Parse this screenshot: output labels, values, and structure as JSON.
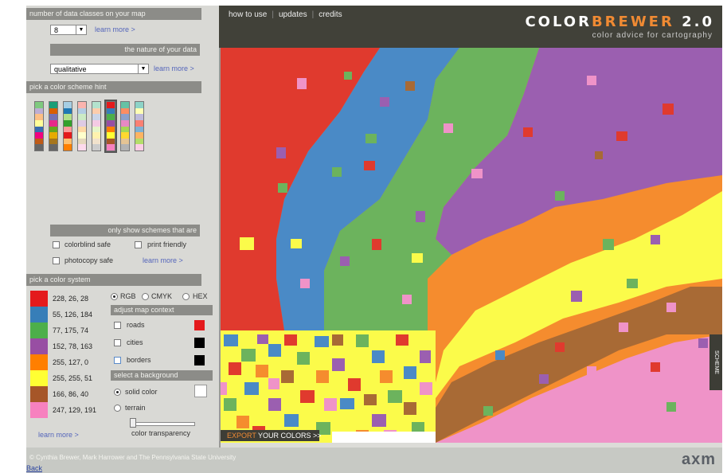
{
  "left": {
    "classes": {
      "header": "number of data classes on your map",
      "value": "8",
      "learn_more": "learn more >"
    },
    "nature": {
      "header": "the nature of your data",
      "value": "qualitative",
      "learn_more": "learn more >"
    },
    "scheme_header": "pick a color scheme hint",
    "schemes": [
      [
        "#7fc97f",
        "#beaed4",
        "#fdc086",
        "#ffff99",
        "#386cb0",
        "#f0027f",
        "#bf5b17",
        "#666666"
      ],
      [
        "#1b9e77",
        "#d95f02",
        "#7570b3",
        "#e7298a",
        "#66a61e",
        "#e6ab02",
        "#a6761d",
        "#666666"
      ],
      [
        "#a6cee3",
        "#1f78b4",
        "#b2df8a",
        "#33a02c",
        "#fb9a99",
        "#e31a1c",
        "#fdbf6f",
        "#ff7f00"
      ],
      [
        "#fbb4ae",
        "#b3cde3",
        "#ccebc5",
        "#decbe4",
        "#fed9a6",
        "#ffffcc",
        "#e5d8bd",
        "#fddaec"
      ],
      [
        "#b3e2cd",
        "#fdcdac",
        "#cbd5e8",
        "#f4cae4",
        "#e6f5c9",
        "#fff2ae",
        "#f1e2cc",
        "#cccccc"
      ],
      [
        "#e41a1c",
        "#377eb8",
        "#4daf4a",
        "#984ea3",
        "#ff7f00",
        "#ffff33",
        "#a65628",
        "#f781bf"
      ],
      [
        "#66c2a5",
        "#fc8d62",
        "#8da0cb",
        "#e78ac3",
        "#a6d854",
        "#ffd92f",
        "#e5c494",
        "#b3b3b3"
      ],
      [
        "#8dd3c7",
        "#ffffb3",
        "#bebada",
        "#fb8072",
        "#80b1d3",
        "#fdb462",
        "#b3de69",
        "#fccde5"
      ]
    ],
    "filters": {
      "header": "only show schemes that are",
      "colorblind": "colorblind safe",
      "print": "print friendly",
      "photocopy": "photocopy safe",
      "learn_more": "learn more >"
    },
    "color_system": {
      "header": "pick a color system",
      "options": [
        "RGB",
        "CMYK",
        "HEX"
      ],
      "selected": "RGB"
    },
    "swatches": [
      {
        "color": "#e41a1c",
        "value": "228, 26, 28"
      },
      {
        "color": "#377eb8",
        "value": "55, 126, 184"
      },
      {
        "color": "#4daf4a",
        "value": "77, 175, 74"
      },
      {
        "color": "#984ea3",
        "value": "152, 78, 163"
      },
      {
        "color": "#ff7f00",
        "value": "255, 127, 0"
      },
      {
        "color": "#ffff33",
        "value": "255, 255, 51"
      },
      {
        "color": "#a65628",
        "value": "166, 86, 40"
      },
      {
        "color": "#f781bf",
        "value": "247, 129, 191"
      }
    ],
    "swatch_learn_more": "learn more >",
    "adjust": {
      "header": "adjust map context",
      "roads": "roads",
      "cities": "cities",
      "borders": "borders"
    },
    "background": {
      "header": "select a background",
      "solid": "solid color",
      "terrain": "terrain",
      "transparency": "color transparency"
    }
  },
  "topbar": {
    "nav": [
      "how to use",
      "updates",
      "credits"
    ],
    "brand_a": "COLOR",
    "brand_b": "BREWER",
    "brand_c": " 2.0",
    "tagline": "color advice for cartography"
  },
  "map": {
    "export_label_a": "EXPORT",
    "export_label_b": " YOUR COLORS >>",
    "side_tab": "SCHEME"
  },
  "footer": {
    "copyright": "© Cynthia Brewer, Mark Harrower and The Pennsylvania State University",
    "back": "Back",
    "logo": "axm"
  },
  "colors": {
    "red": "#e03a2e",
    "blue": "#4a8ac6",
    "green": "#6cb35d",
    "purple": "#9b5fb0",
    "orange": "#f58c2e",
    "yellow": "#fbfb4a",
    "brown": "#a86a35",
    "pink": "#ef93c8"
  }
}
